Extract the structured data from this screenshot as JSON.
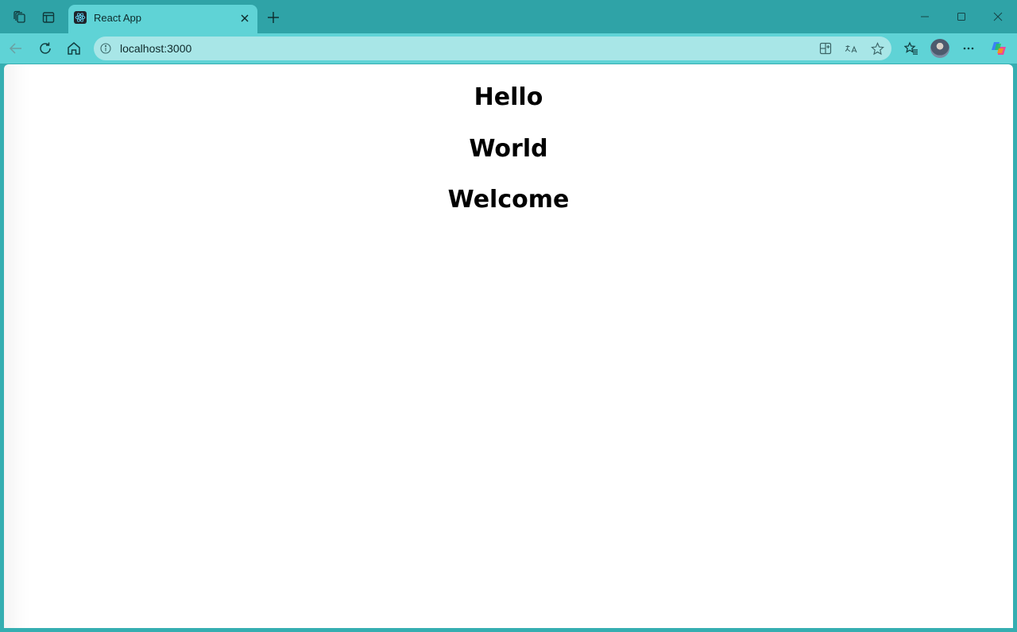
{
  "browser": {
    "tab": {
      "title": "React App"
    },
    "address_bar": {
      "url": "localhost:3000"
    }
  },
  "page": {
    "headings": [
      "Hello",
      "World",
      "Welcome"
    ]
  },
  "colors": {
    "tab_strip": "#2fa3a7",
    "toolbar": "#5fd3d6",
    "address_bar": "#a8e6e7",
    "page_background": "#ffffff"
  }
}
